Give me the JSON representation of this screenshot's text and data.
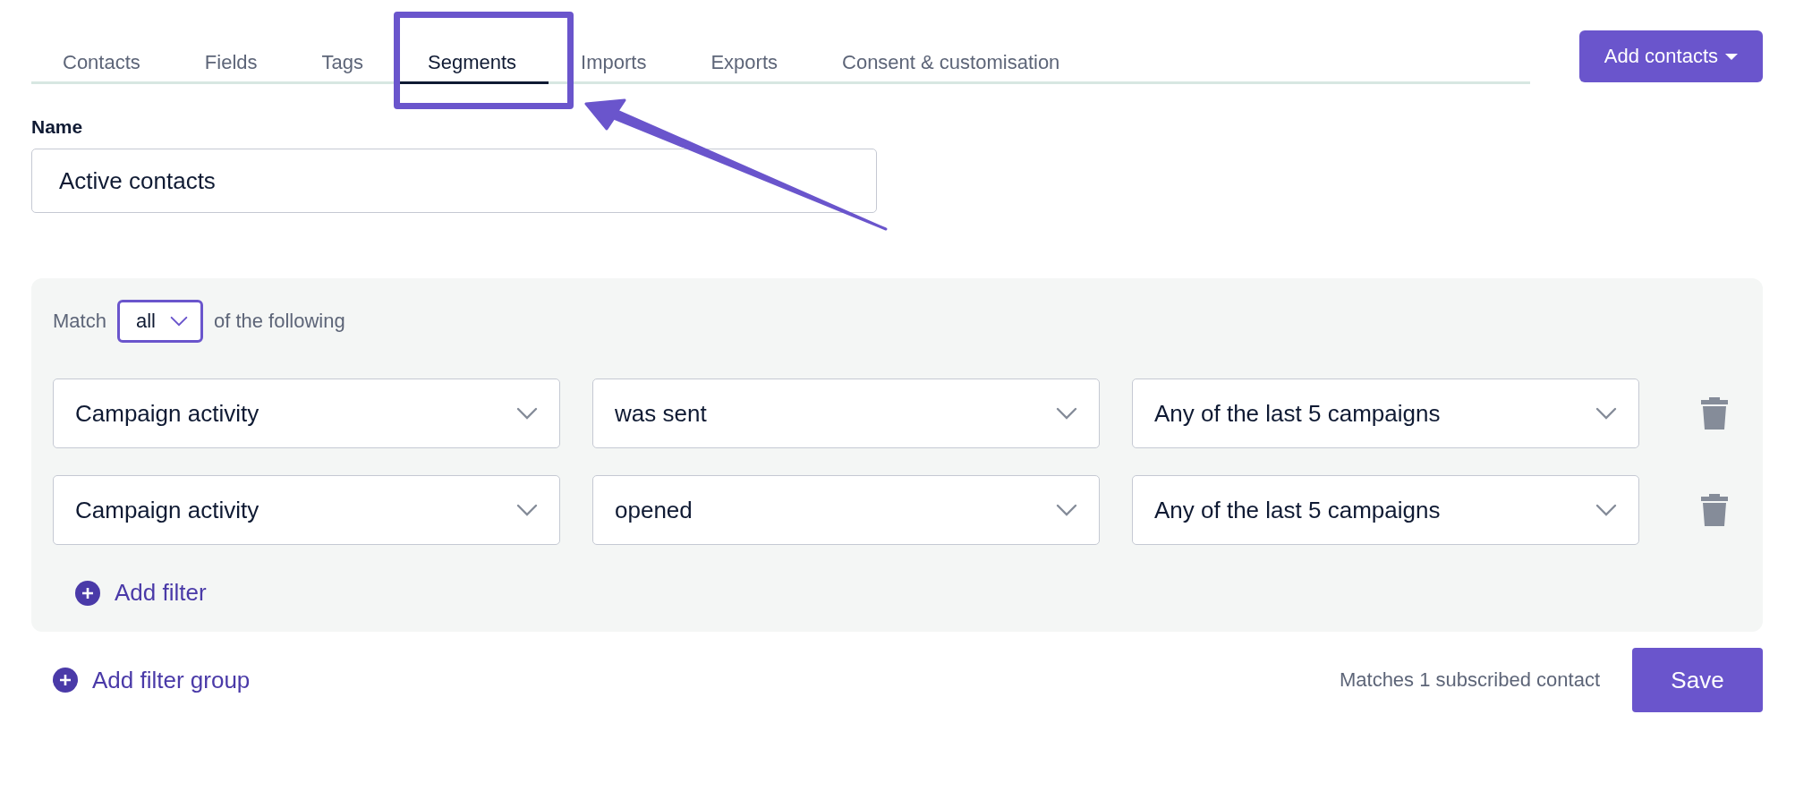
{
  "tabs": [
    {
      "label": "Contacts",
      "selected": false
    },
    {
      "label": "Fields",
      "selected": false
    },
    {
      "label": "Tags",
      "selected": false
    },
    {
      "label": "Segments",
      "selected": true
    },
    {
      "label": "Imports",
      "selected": false
    },
    {
      "label": "Exports",
      "selected": false
    },
    {
      "label": "Consent & customisation",
      "selected": false
    }
  ],
  "add_contacts_button": {
    "label": "Add contacts"
  },
  "name_field": {
    "label": "Name",
    "value": "Active contacts"
  },
  "filter_group": {
    "match_label": "Match",
    "match_value": "all",
    "match_suffix": "of the following",
    "filters": [
      {
        "field": "Campaign activity",
        "condition": "was sent",
        "scope": "Any of the last 5 campaigns"
      },
      {
        "field": "Campaign activity",
        "condition": "opened",
        "scope": "Any of the last 5 campaigns"
      }
    ],
    "add_filter": "Add filter"
  },
  "add_filter_group": "Add filter group",
  "match_count": "Matches 1 subscribed contact",
  "save_button": "Save"
}
